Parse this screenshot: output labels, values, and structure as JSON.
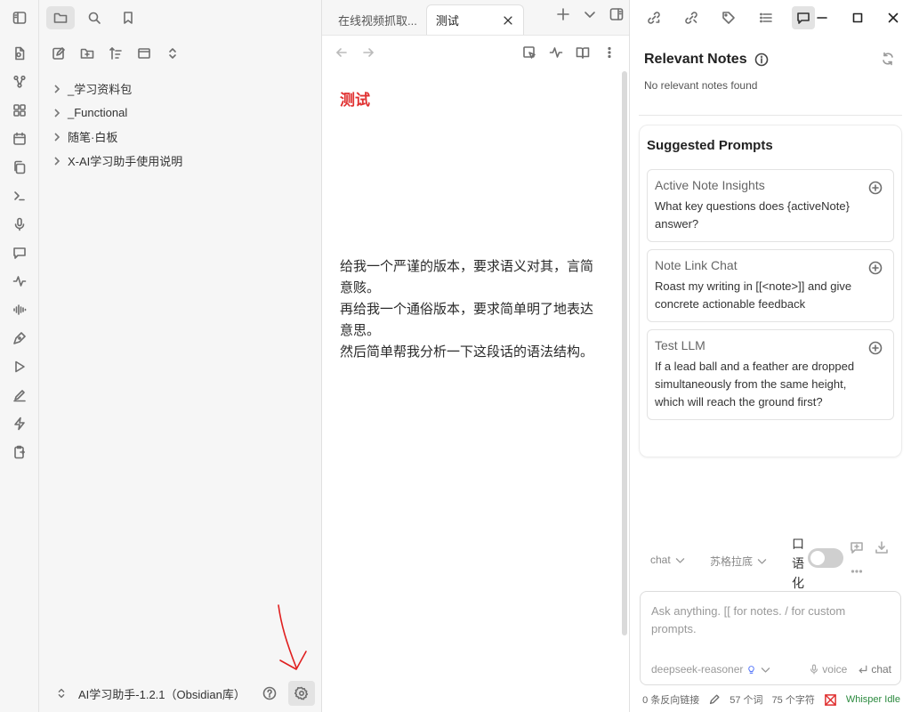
{
  "explorer": {
    "tree": [
      {
        "label": "_学习资料包"
      },
      {
        "label": "_Functional"
      },
      {
        "label": "随笔·白板"
      },
      {
        "label": "X-AI学习助手使用说明"
      }
    ],
    "vault_name": "AI学习助手-1.2.1（Obsidian库）"
  },
  "editor": {
    "tabs": [
      {
        "label": "在线视频抓取..."
      },
      {
        "label": "测试"
      }
    ],
    "note_title": "测试",
    "body_lines": [
      "给我一个严谨的版本，要求语义对其，言简意赅。",
      "再给我一个通俗版本，要求简单明了地表达意思。",
      "然后简单帮我分析一下这段话的语法结构。"
    ]
  },
  "copilot": {
    "relevant_title": "Relevant Notes",
    "relevant_empty": "No relevant notes found",
    "suggested_title": "Suggested Prompts",
    "prompts": [
      {
        "title": "Active Note Insights",
        "body": "What key questions does {activeNote} answer?"
      },
      {
        "title": "Note Link Chat",
        "body": "Roast my writing in [[<note>]] and give concrete actionable feedback"
      },
      {
        "title": "Test LLM",
        "body": "If a lead ball and a feather are dropped simultaneously from the same height, which will reach the ground first?"
      }
    ],
    "mode_select": "chat",
    "persona_select": "苏格拉底",
    "colloquial_label": "口语化",
    "input_placeholder": "Ask anything. [[ for notes. / for custom prompts.",
    "model": "deepseek-reasoner",
    "voice_label": "voice",
    "chat_label": "chat"
  },
  "status": {
    "backlinks": "0 条反向链接",
    "words": "57 个词",
    "chars": "75 个字符",
    "whisper": "Whisper Idle"
  },
  "colors": {
    "title_red": "#e03131",
    "whisper_green": "#2b8a3e",
    "annotation_red": "#e02020"
  }
}
